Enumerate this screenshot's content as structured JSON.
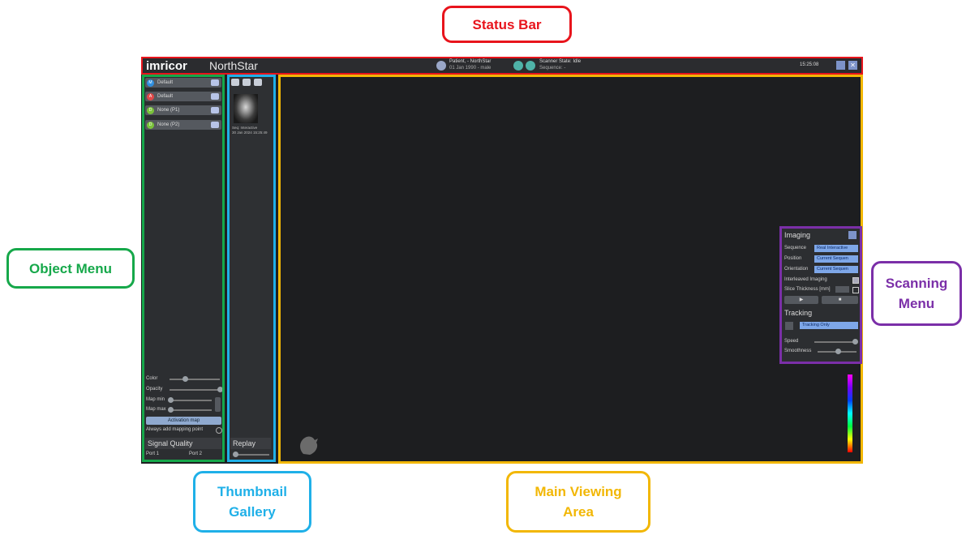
{
  "callouts": {
    "status_bar": "Status Bar",
    "object_menu": "Object Menu",
    "scanning_menu_line1": "Scanning",
    "scanning_menu_line2": "Menu",
    "thumbnail_gallery_line1": "Thumbnail",
    "thumbnail_gallery_line2": "Gallery",
    "main_viewing_line1": "Main Viewing",
    "main_viewing_line2": "Area"
  },
  "colors": {
    "status_bar": "#e8141c",
    "object_menu": "#16a84a",
    "thumbnail_gallery": "#1fb0e8",
    "main_viewing": "#f2b705",
    "scanning_menu": "#7b2fa8"
  },
  "status": {
    "logo": "imricor",
    "app_name": "NorthStar",
    "patient_line1": "Patient, - NorthStar",
    "patient_line2": "01 Jan 1990 - male",
    "scanner_state": "Scanner State: Idle",
    "sequence": "Sequence: -",
    "time": "15:25:08"
  },
  "object_menu": {
    "items": [
      {
        "badge": "M",
        "label": "Default",
        "color": "#2f8fe0"
      },
      {
        "badge": "A",
        "label": "Default",
        "color": "#e04848"
      },
      {
        "badge": "D",
        "label": "None (P1)",
        "color": "#7ac23a"
      },
      {
        "badge": "D",
        "label": "None (P2)",
        "color": "#7ac23a"
      }
    ],
    "color_label": "Color",
    "opacity_label": "Opacity",
    "map_min_label": "Map min",
    "map_max_label": "Map max",
    "activation_map_button": "Activation map",
    "always_add_label": "Always add mapping point",
    "signal_quality": "Signal Quality",
    "port1": "Port 1",
    "port2": "Port 2"
  },
  "thumbnail": {
    "caption_line1": "Seq: Interactive",
    "caption_line2": "30 Jan 2024 15:25:49",
    "replay_label": "Replay"
  },
  "scanning_menu": {
    "imaging_title": "Imaging",
    "sequence_label": "Sequence",
    "sequence_value": "Real Interactive",
    "position_label": "Position",
    "position_value": "Current Sequen",
    "orientation_label": "Orientation",
    "orientation_value": "Current Sequen",
    "interleaved_label": "Interleaved Imaging",
    "slice_thickness_label": "Slice Thickness [mm]",
    "tracking_title": "Tracking",
    "tracking_value": "Tracking Only",
    "speed_label": "Speed",
    "smoothness_label": "Smoothness"
  }
}
